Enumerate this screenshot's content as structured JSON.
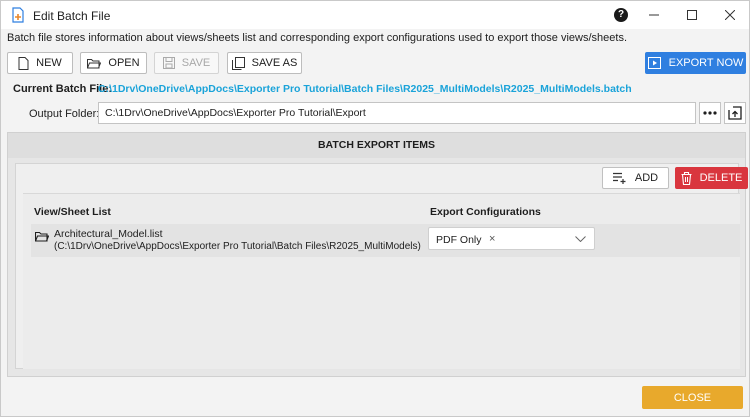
{
  "window": {
    "title": "Edit Batch File",
    "help_glyph": "?",
    "description": "Batch file stores information about views/sheets list and corresponding export configurations used to export those views/sheets."
  },
  "toolbar": {
    "new_label": "NEW",
    "open_label": "OPEN",
    "save_label": "SAVE",
    "save_as_label": "SAVE AS",
    "export_label": "EXPORT NOW"
  },
  "current_batch": {
    "label": "Current Batch File:",
    "path": "C:\\1Drv\\OneDrive\\AppDocs\\Exporter Pro Tutorial\\Batch Files\\R2025_MultiModels\\R2025_MultiModels.batch"
  },
  "output": {
    "label": "Output Folder:",
    "value": "C:\\1Drv\\OneDrive\\AppDocs\\Exporter Pro Tutorial\\Export"
  },
  "batch_panel": {
    "header": "BATCH EXPORT ITEMS",
    "add_label": "ADD",
    "delete_label": "DELETE",
    "columns": [
      "View/Sheet List",
      "Export Configurations"
    ],
    "rows": [
      {
        "name": "Architectural_Model.list",
        "path": "(C:\\1Drv\\OneDrive\\AppDocs\\Exporter Pro Tutorial\\Batch Files\\R2025_MultiModels)",
        "config": "PDF Only",
        "remove_glyph": "×"
      }
    ]
  },
  "footer": {
    "close_label": "CLOSE"
  },
  "colors": {
    "accent": "#2f7fe0",
    "delete": "#d9363e",
    "close": "#e8a92c",
    "path_link": "#1aa3d9"
  }
}
